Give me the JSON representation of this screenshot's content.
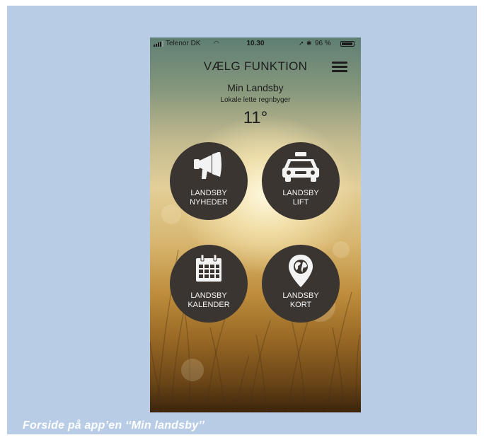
{
  "status_bar": {
    "carrier": "Telenor DK",
    "time": "10.30",
    "battery": "96 %",
    "battery_level_pct": 96,
    "icons": [
      "signal-icon",
      "wifi-icon",
      "location-icon",
      "bluetooth-icon",
      "battery-icon"
    ]
  },
  "header": {
    "title": "VÆLG FUNKTION",
    "menu_icon": "hamburger-menu-icon"
  },
  "info": {
    "village": "Min Landsby",
    "weather": "Lokale lette regnbyger",
    "temperature": "11°"
  },
  "tiles": [
    {
      "line1": "LANDSBY",
      "line2": "NYHEDER",
      "icon": "megaphone-icon"
    },
    {
      "line1": "LANDSBY",
      "line2": "LIFT",
      "icon": "taxi-icon"
    },
    {
      "line1": "LANDSBY",
      "line2": "KALENDER",
      "icon": "calendar-icon"
    },
    {
      "line1": "LANDSBY",
      "line2": "KORT",
      "icon": "map-pin-icon"
    }
  ],
  "caption": "Forside på app’en ‘‘Min landsby’’",
  "colors": {
    "frame_background": "#b8cce6",
    "tile_background": "#3b3531",
    "caption_text": "#ffffff"
  }
}
